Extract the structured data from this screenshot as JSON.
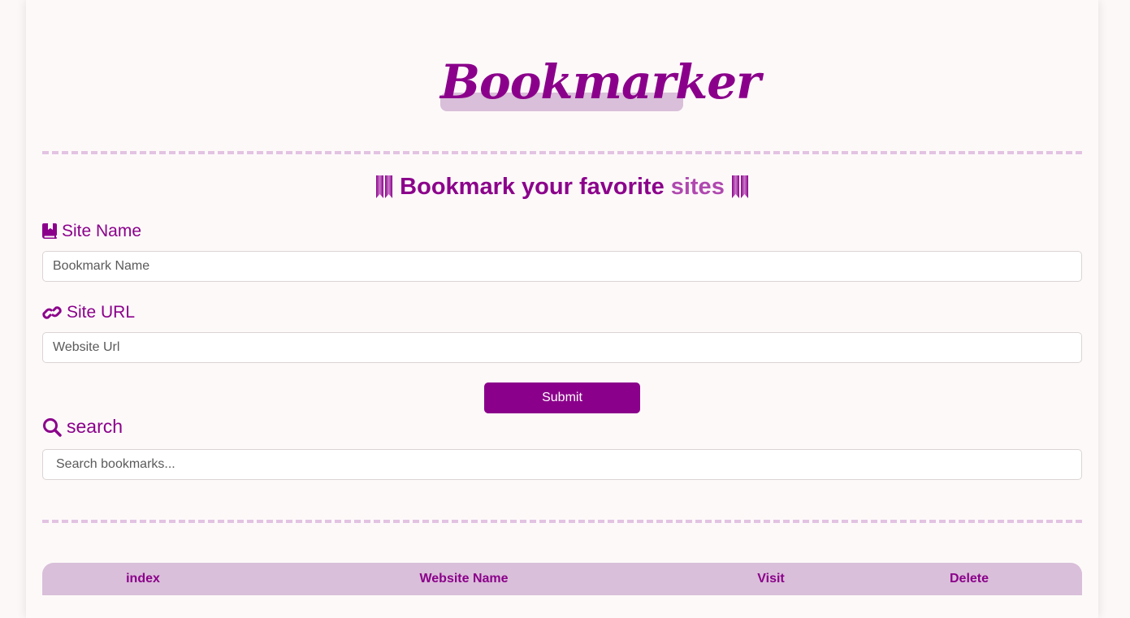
{
  "header": {
    "logo_text": "Bookmarker",
    "subtitle_part1": "Bookmark your favorite",
    "subtitle_part2": "sites"
  },
  "form": {
    "site_name_label": "Site Name",
    "site_name_placeholder": "Bookmark Name",
    "site_url_label": "Site URL",
    "site_url_placeholder": "Website Url",
    "submit_label": "Submit"
  },
  "search": {
    "label": "search",
    "placeholder": "Search bookmarks..."
  },
  "table": {
    "columns": [
      "index",
      "Website Name",
      "Visit",
      "Delete"
    ]
  },
  "icons": {
    "subtitle_left": "bookmark-ribbon-icon",
    "subtitle_right": "bookmark-ribbon-icon",
    "site_name": "book-bookmark-icon",
    "site_url": "link-icon",
    "search": "magnifier-icon"
  },
  "colors": {
    "accent": "#8b008b",
    "accent_light": "#b049b0",
    "highlight": "#d9bfd9",
    "background": "#fdf9f9"
  }
}
